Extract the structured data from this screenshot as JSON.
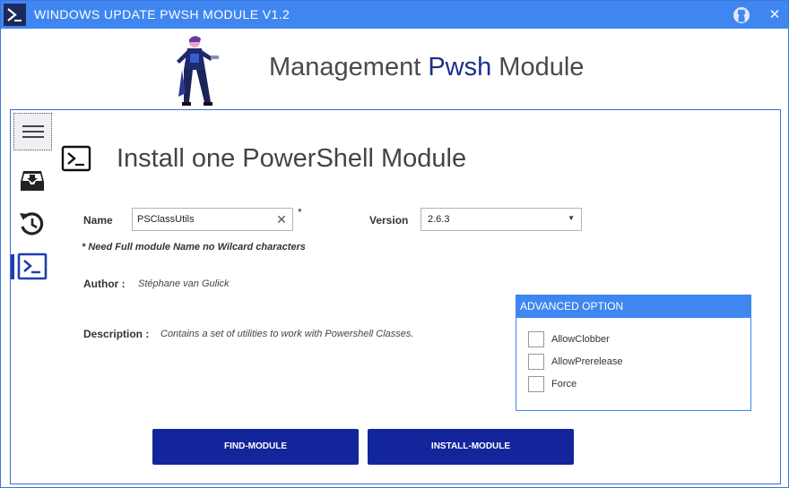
{
  "window": {
    "title": "WINDOWS UPDATE PWSH MODULE V1.2",
    "close_glyph": "✕",
    "app_icon": "powershell-prompt-icon",
    "github_icon": "github-icon"
  },
  "header": {
    "title_part1": "Management ",
    "title_accent": "Pwsh",
    "title_part2": " Module",
    "accent_color": "#1a2f8c"
  },
  "sidebar": {
    "items": [
      {
        "name": "menu",
        "icon": "hamburger-icon",
        "active": false
      },
      {
        "name": "installed-modules",
        "icon": "inbox-tray-icon",
        "active": false
      },
      {
        "name": "update",
        "icon": "history-refresh-icon",
        "active": false
      },
      {
        "name": "install",
        "icon": "terminal-prompt-icon",
        "active": true
      }
    ]
  },
  "page": {
    "title": "Install one PowerShell Module",
    "icon": "terminal-prompt-icon",
    "name_label": "Name",
    "name_value": "PSClassUtils",
    "required_mark": "*",
    "version_label": "Version",
    "version_value": "2.6.3",
    "note": "* Need Full module Name no Wilcard characters",
    "author_label": "Author :",
    "author_value": "Stéphane van Gulick",
    "description_label": "Description :",
    "description_value": "Contains a set of utilities to work with Powershell Classes."
  },
  "advanced": {
    "header": "ADVANCED OPTION",
    "options": [
      {
        "label": "AllowClobber",
        "checked": false
      },
      {
        "label": "AllowPrerelease",
        "checked": false
      },
      {
        "label": "Force",
        "checked": false
      }
    ]
  },
  "buttons": {
    "find": "FIND-MODULE",
    "install": "INSTALL-MODULE"
  },
  "colors": {
    "titlebar": "#3f86f1",
    "primary_button": "#13259b",
    "frame_border": "#3a6fd0"
  }
}
